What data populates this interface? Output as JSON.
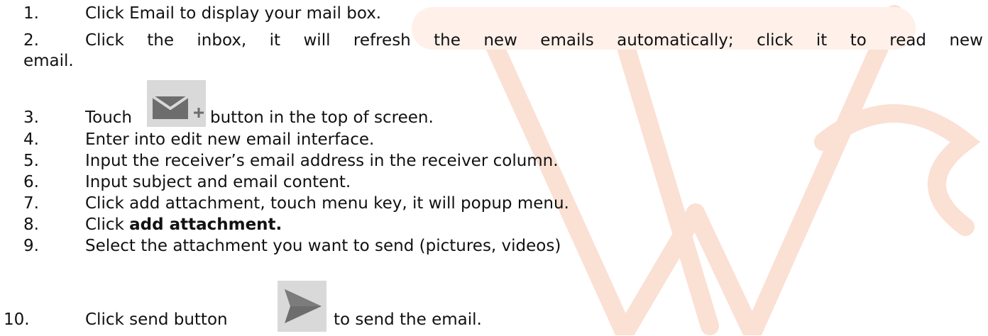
{
  "steps": [
    {
      "num": "1.",
      "text": "Click Email to display your mail box."
    },
    {
      "num": "2.",
      "text": "Click the inbox, it will refresh the new emails automatically; click it to read new",
      "cont": "email."
    },
    {
      "num": "3.",
      "pre": "Touch",
      "icon": "compose-mail-icon",
      "post": "button in the top of screen."
    },
    {
      "num": "4.",
      "text": "Enter into edit new email interface."
    },
    {
      "num": "5.",
      "text": "Input the receiver’s email address in the receiver column."
    },
    {
      "num": "6.",
      "text": "Input subject and email content."
    },
    {
      "num": "7.",
      "text": "Click add attachment, touch menu key, it will popup menu."
    },
    {
      "num": "8.",
      "pre": "Click ",
      "bold": "add attachment."
    },
    {
      "num": "9.",
      "text": "Select the attachment you want to send (pictures, videos)"
    },
    {
      "num": "10.",
      "pre": "Click send button",
      "icon": "send-arrow-icon",
      "post": "to send the email."
    }
  ],
  "watermark": {
    "color": "#f0b49a"
  }
}
